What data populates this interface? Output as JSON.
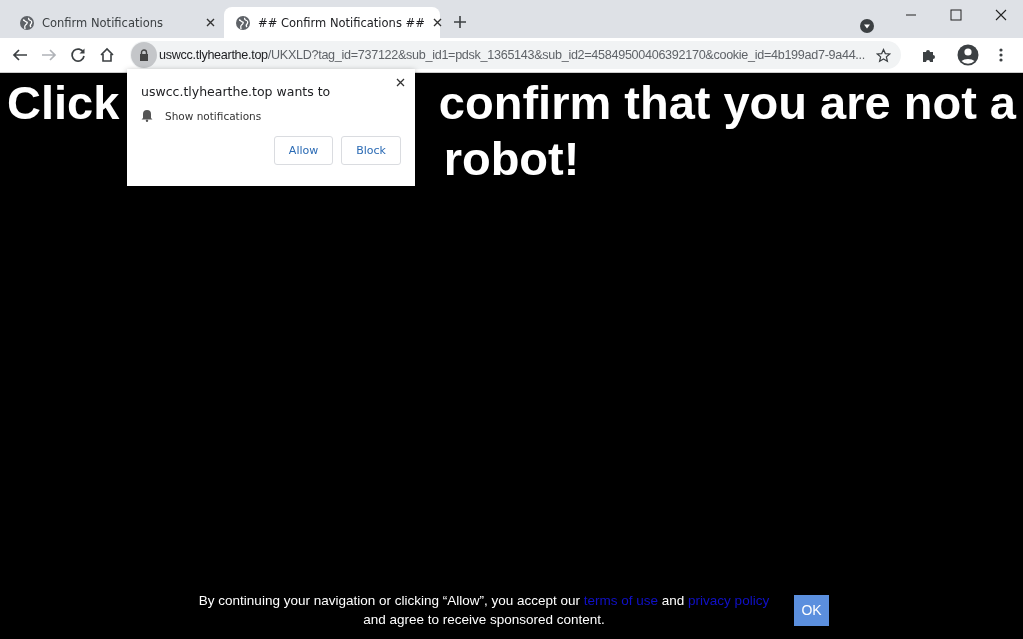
{
  "tabs": [
    {
      "title": "Confirm Notifications",
      "selected": false
    },
    {
      "title": "## Confirm Notifications ##",
      "selected": true
    }
  ],
  "address_bar": {
    "host": "uswcc.tlyhearthe.top",
    "path": "/UKXLD?tag_id=737122&sub_id1=pdsk_1365143&sub_id2=45849500406392170&cookie_id=4b199ad7-9a44..."
  },
  "permission_popup": {
    "title": "uswcc.tlyhearthe.top wants to",
    "permission": "Show notifications",
    "buttons": [
      "Allow",
      "Block"
    ]
  },
  "headline": {
    "line_1_left": "Click",
    "line_1_right": "confirm that you are not a",
    "line_2": "robot!"
  },
  "consent_bar": {
    "text_before": "By continuing your navigation or clicking “Allow”, you accept our",
    "link_1": "terms of use",
    "text_middle": "and",
    "link_2": "privacy policy",
    "text_after": "and agree to receive sponsored content.",
    "button": "OK"
  }
}
